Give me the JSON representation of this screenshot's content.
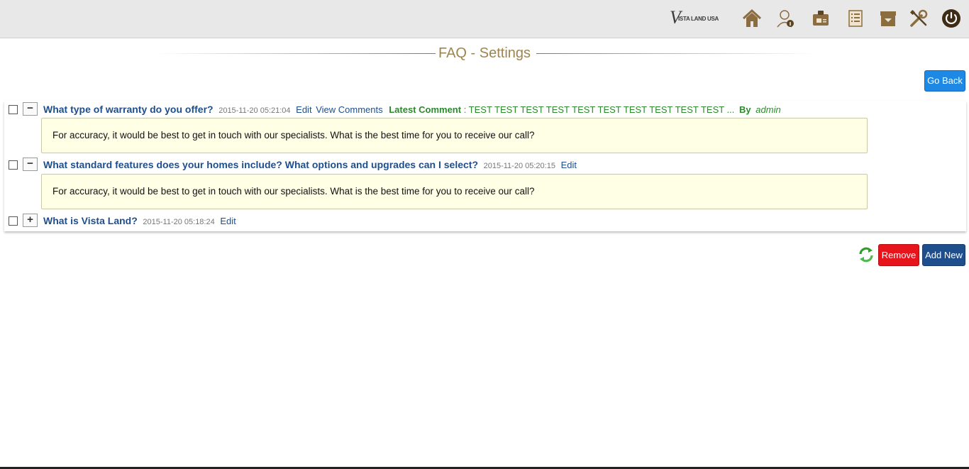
{
  "header": {
    "logo": {
      "initial": "V",
      "text": "ISTA LAND USA"
    },
    "nav_icons": [
      "home-icon",
      "user-info-icon",
      "id-card-icon",
      "list-icon",
      "archive-icon",
      "tools-icon",
      "power-icon"
    ],
    "icon_color": "#8b6d3f"
  },
  "page": {
    "title": "FAQ - Settings",
    "go_back_label": "Go Back"
  },
  "faqs": [
    {
      "toggle": "−",
      "question": "What type of warranty do you offer?",
      "date": "2015-11-20 05:21:04",
      "edit_label": "Edit",
      "view_comments_label": "View Comments",
      "latest_comment_label": "Latest Comment",
      "latest_comment_text": " : TEST TEST TEST TEST TEST TEST TEST TEST TEST TEST ...",
      "by_label": "By",
      "by_user": "admin",
      "answer": "For accuracy, it would be best to get in touch with our specialists. What is the best time for you to receive our call?"
    },
    {
      "toggle": "−",
      "question": "What standard features does your homes include? What options and upgrades can I select?",
      "date": "2015-11-20 05:20:15",
      "edit_label": "Edit",
      "answer": "For accuracy, it would be best to get in touch with our specialists. What is the best time for you to receive our call?"
    },
    {
      "toggle": "+",
      "question": "What is Vista Land?",
      "date": "2015-11-20 05:18:24",
      "edit_label": "Edit"
    }
  ],
  "actions": {
    "remove_label": "Remove",
    "add_new_label": "Add New"
  },
  "colors": {
    "title_gold": "#9c8550",
    "link_blue": "#1f4e8c",
    "comment_green": "#2b8a2b",
    "remove_red": "#e8141b",
    "go_back_blue": "#1e88e5"
  }
}
